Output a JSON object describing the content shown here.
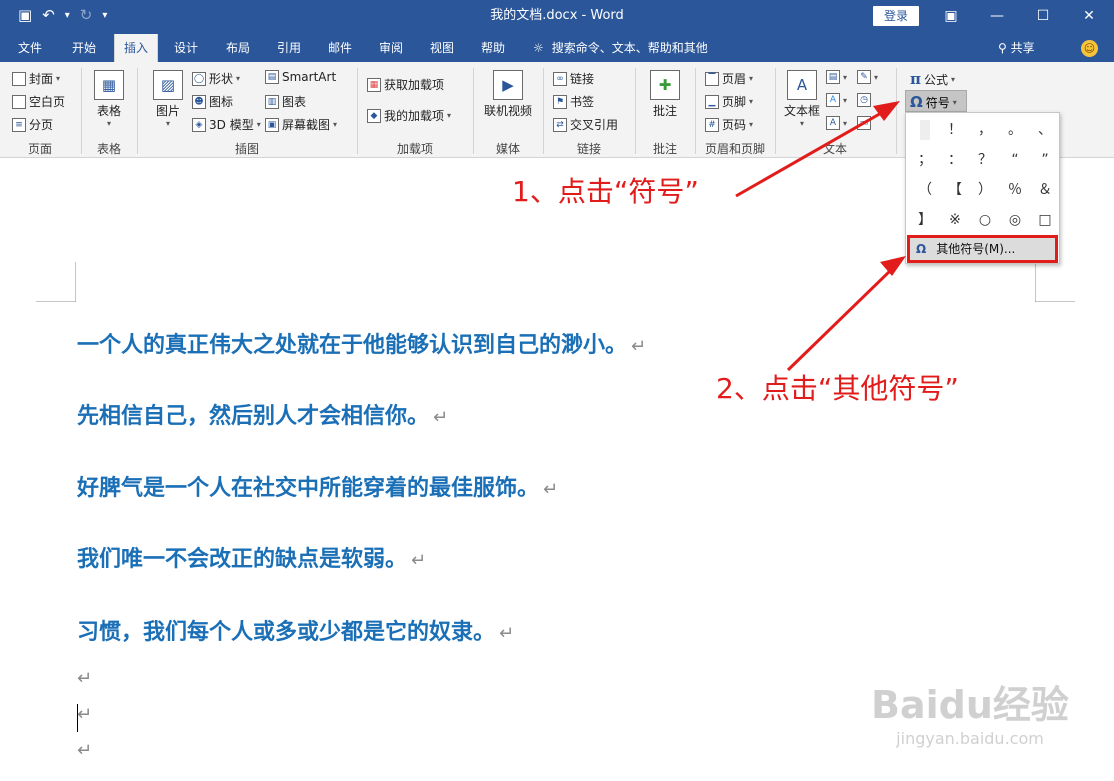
{
  "window": {
    "title": "我的文档.docx - Word",
    "login_label": "登录",
    "controls": {
      "ribbon_display": "▣",
      "minimize": "—",
      "maximize": "☐",
      "close": "✕"
    }
  },
  "qat": {
    "save": "▣",
    "undo": "↶",
    "undo_caret": "▾",
    "redo": "↻",
    "customize": "▾"
  },
  "tabs": [
    {
      "label": "文件"
    },
    {
      "label": "开始"
    },
    {
      "label": "插入"
    },
    {
      "label": "设计"
    },
    {
      "label": "布局"
    },
    {
      "label": "引用"
    },
    {
      "label": "邮件"
    },
    {
      "label": "审阅"
    },
    {
      "label": "视图"
    },
    {
      "label": "帮助"
    }
  ],
  "active_tab": "插入",
  "tellme": {
    "icon": "lightbulb-icon",
    "text": "搜索命令、文本、帮助和其他"
  },
  "share_label": "共享",
  "ribbon": {
    "pages": {
      "label": "页面",
      "cover": "封面",
      "blank": "空白页",
      "break": "分页"
    },
    "table": {
      "label": "表格",
      "button": "表格"
    },
    "illustrations": {
      "label": "插图",
      "picture": "图片",
      "shapes": "形状",
      "icons": "图标",
      "model3d": "3D 模型",
      "smartart": "SmartArt",
      "chart": "图表",
      "screenshot": "屏幕截图"
    },
    "addins": {
      "label": "加载项",
      "get": "获取加载项",
      "mine": "我的加载项"
    },
    "media": {
      "label": "媒体",
      "video": "联机视频"
    },
    "links": {
      "label": "链接",
      "link": "链接",
      "bookmark": "书签",
      "crossref": "交叉引用"
    },
    "comments": {
      "label": "批注",
      "comment": "批注"
    },
    "header_footer": {
      "label": "页眉和页脚",
      "header": "页眉",
      "footer": "页脚",
      "page_number": "页码"
    },
    "text": {
      "label": "文本",
      "textbox": "文本框"
    },
    "symbols": {
      "equation": "公式",
      "symbol": "符号"
    }
  },
  "symbol_dropdown": {
    "symbols": [
      "",
      "！",
      "，",
      "。",
      "、",
      "；",
      "：",
      "？",
      "“",
      "”",
      "（",
      "【",
      "）",
      "％",
      "＆",
      "】",
      "※",
      "○",
      "◎",
      "□"
    ],
    "more_label": "其他符号(M)..."
  },
  "document": {
    "paragraphs": [
      "一个人的真正伟大之处就在于他能够认识到自己的渺小。",
      "先相信自己，然后别人才会相信你。",
      "好脾气是一个人在社交中所能穿着的最佳服饰。",
      "我们唯一不会改正的缺点是软弱。",
      "习惯，我们每个人或多或少都是它的奴隶。"
    ],
    "paragraph_mark": "↵"
  },
  "annotations": {
    "step1": "1、点击“符号”",
    "step2": "2、点击“其他符号”"
  },
  "watermark": {
    "main": "Baidu经验",
    "sub": "jingyan.baidu.com"
  },
  "colors": {
    "title_bar": "#2b579a",
    "ribbon_bg": "#f3f3f3",
    "text_blue": "#1a6fb6",
    "annotation_red": "#e21b1b"
  }
}
